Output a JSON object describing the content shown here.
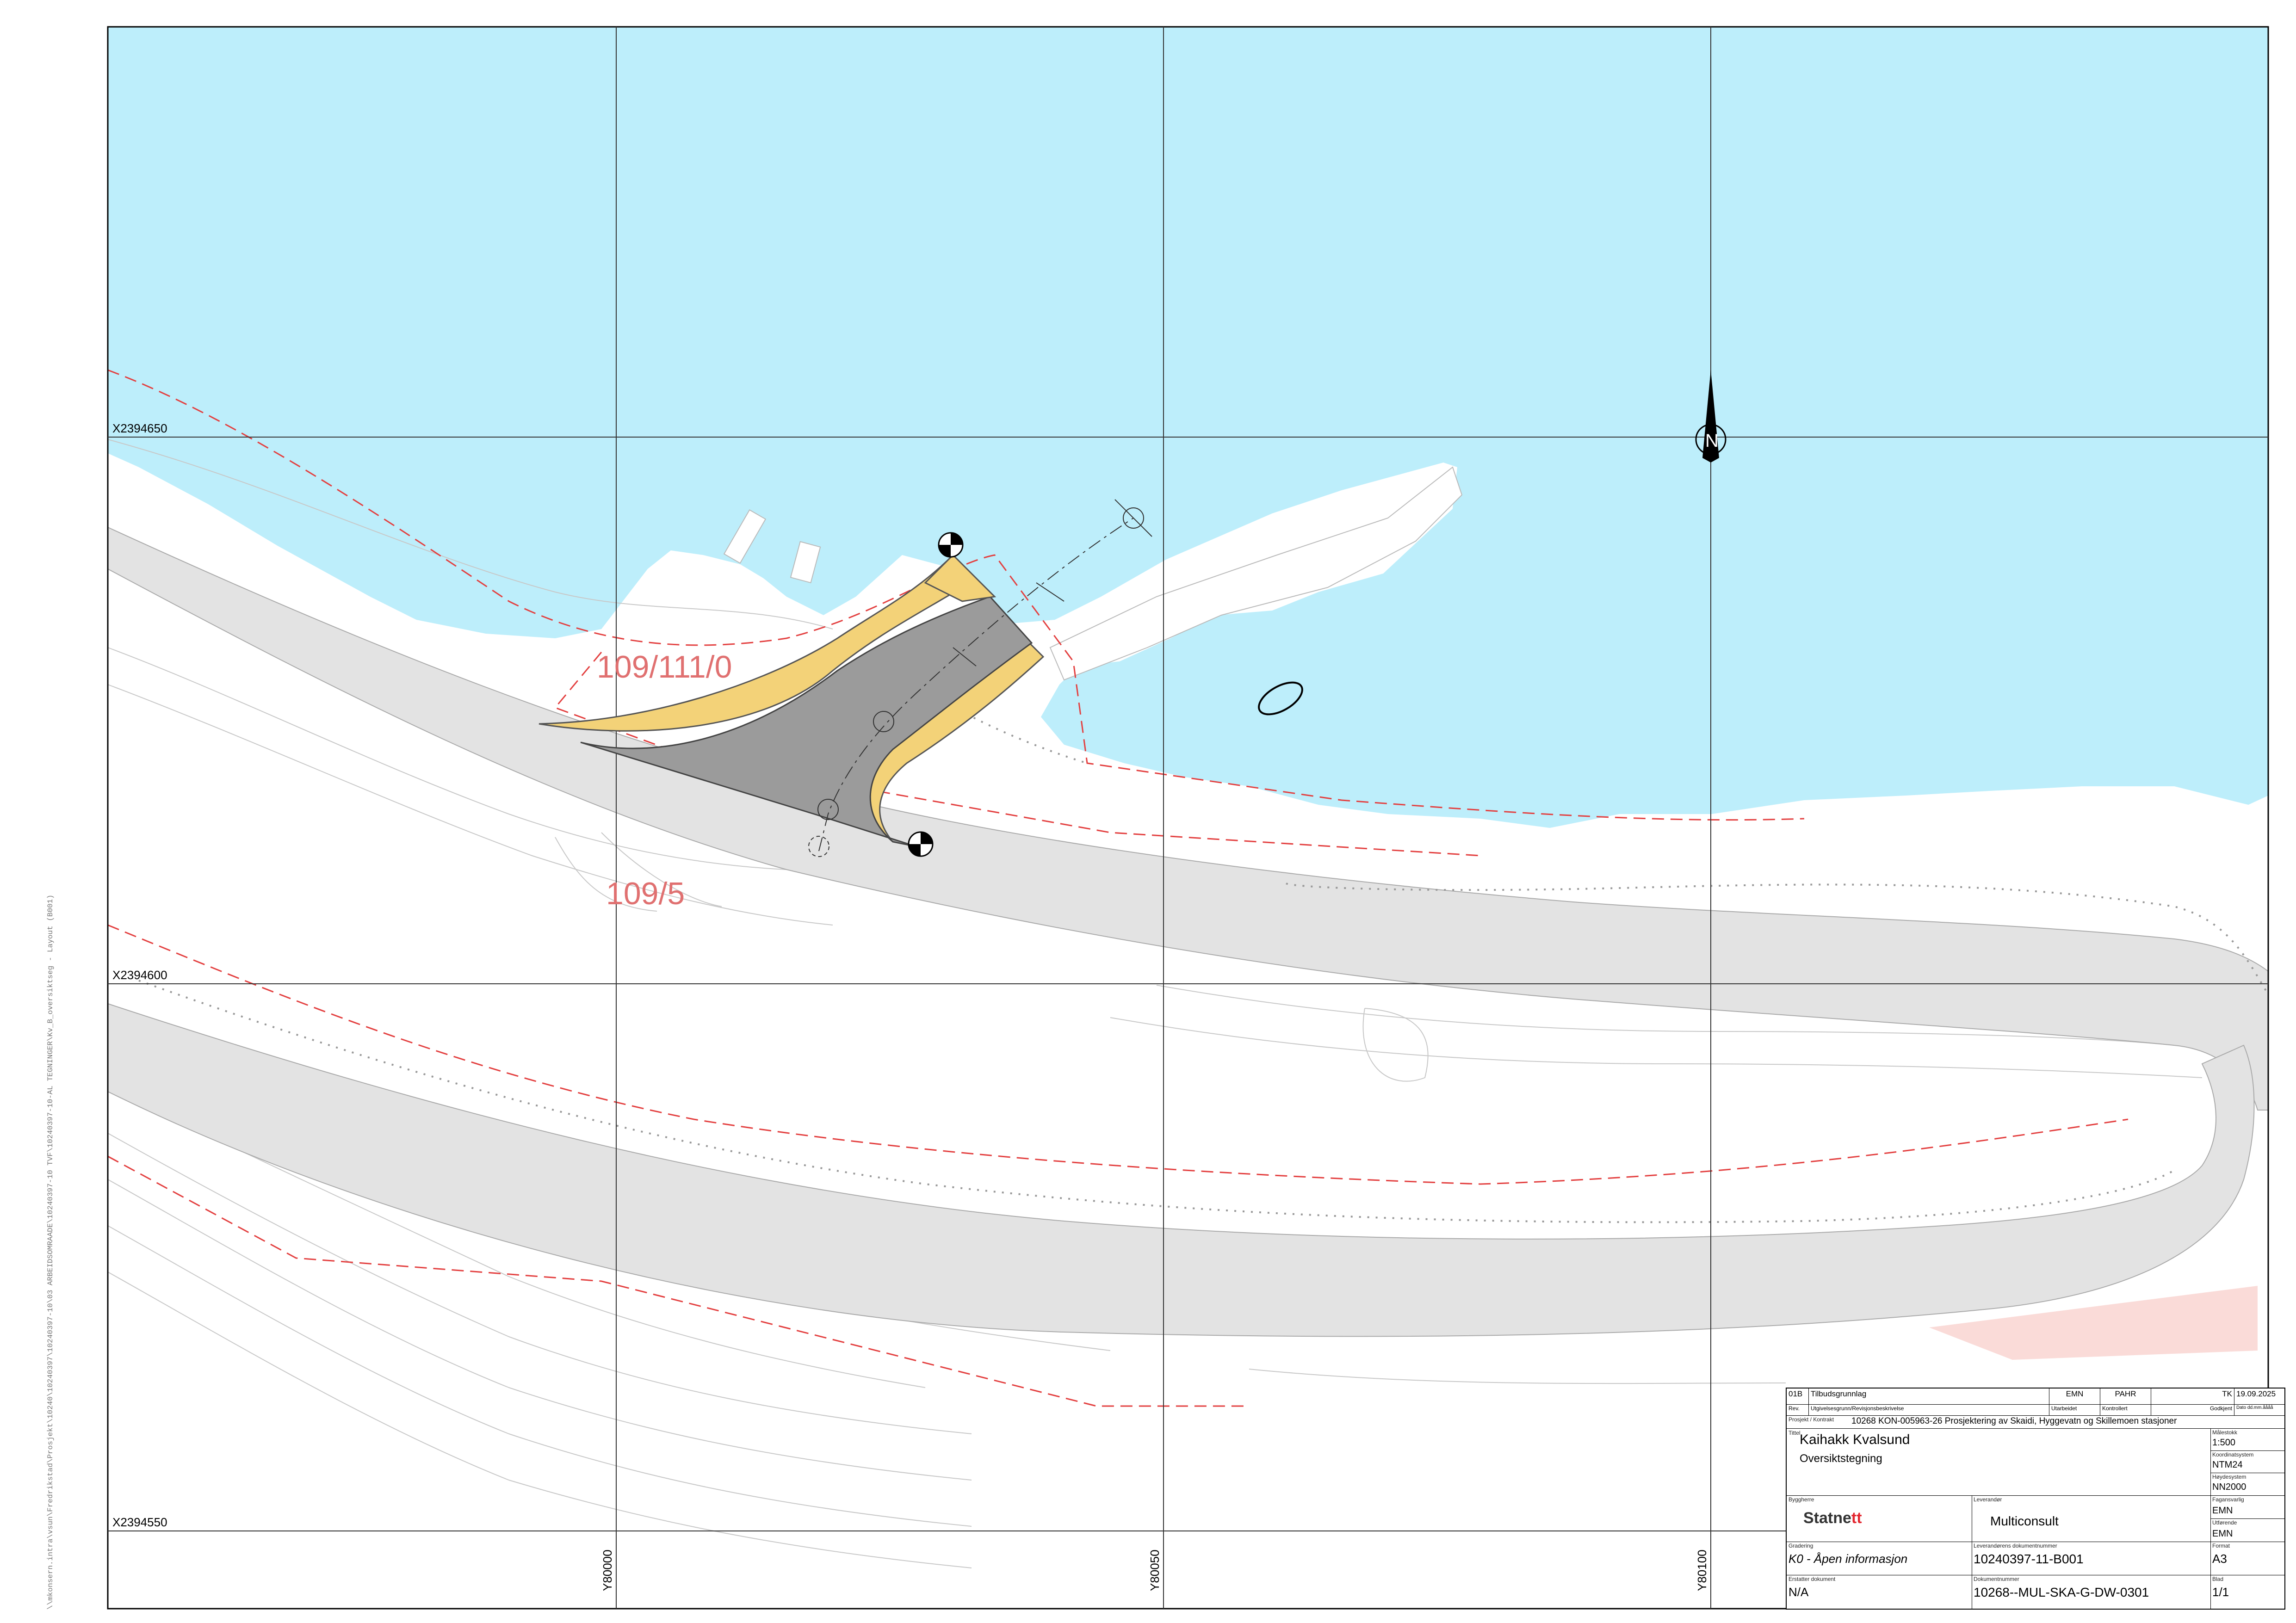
{
  "map": {
    "grid_labels": {
      "x_top": "X2394650",
      "x_mid": "X2394600",
      "x_bottom": "X2394550",
      "y_left": "Y80000",
      "y_mid": "Y80050",
      "y_right": "Y80100"
    },
    "plot_labels": {
      "upper": "109/111/0",
      "lower": "109/5"
    },
    "north_arrow_letter": "N",
    "file_path": "\\\\mkonsern.intra\\vsun\\Fredrikstad\\Prosjekt\\10240\\10240397\\10240397-10\\03 ARBEIDSOMRAADE\\10240397-10 TVF\\10240397-10-AL TEGNINGER\\Kv_B_oversiktseg - Layout (B001)",
    "colors": {
      "water": "#bdeefb",
      "road": "#e3e3e3",
      "paving": "#9b9b9b",
      "slope_fill": "#f3d278",
      "property_line": "#e34040",
      "pink_area": "#fadbd8"
    }
  },
  "title_block": {
    "revision": {
      "rev": "01B",
      "description": "Tilbudsgrunnlag",
      "prepared": "EMN",
      "checked": "PAHR",
      "approved": "TK",
      "date": "19.09.2025"
    },
    "revision_headers": {
      "rev": "Rev.",
      "description": "Utgivelsesgrunn/Revisjonsbeskrivelse",
      "prepared": "Utarbeidet",
      "checked": "Kontrollert",
      "approved": "Godkjent",
      "date": "Dato dd.mm.åååå"
    },
    "project_label": "Prosjekt / Kontrakt",
    "project_value": "10268 KON-005963-26 Prosjektering av Skaidi, Hyggevatn og Skillemoen stasjoner",
    "title_label": "Tittel",
    "title": "Kaihakk Kvalsund",
    "subtitle": "Oversiktstegning",
    "scale_label": "Målestokk",
    "scale": "1:500",
    "coord_label": "Koordinatsystem",
    "coord_system": "NTM24",
    "height_label": "Høydesystem",
    "height_system": "NN2000",
    "owner_label": "Byggherre",
    "owner_logo": {
      "main": "Statne",
      "accent": "tt"
    },
    "supplier_label": "Leverandør",
    "supplier": "Multiconsult",
    "resp_label": "Fagansvarlig",
    "resp": "EMN",
    "issued_label": "Utførende",
    "issued": "EMN",
    "grading_label": "Gradering",
    "grading": "K0 - Åpen informasjon",
    "supplier_doc_label": "Leverandørens dokumentnummer",
    "supplier_doc": "10240397-11-B001",
    "format_label": "Format",
    "format": "A3",
    "replaces_label": "Erstatter dokument",
    "replaces": "N/A",
    "doc_label": "Dokumentnummer",
    "doc_number": "10268--MUL-SKA-G-DW-0301",
    "sheet_label": "Blad",
    "sheet": "1/1"
  }
}
